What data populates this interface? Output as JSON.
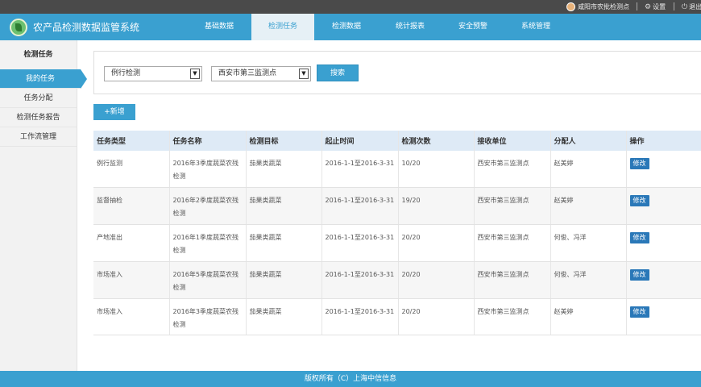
{
  "topbar": {
    "user": "咸阳市农批检测点",
    "settings": "设置",
    "logout": "退出"
  },
  "header": {
    "title": "农产品检测数据监管系统",
    "nav": [
      {
        "label": "基础数据",
        "active": false
      },
      {
        "label": "检测任务",
        "active": true
      },
      {
        "label": "检测数据",
        "active": false
      },
      {
        "label": "统计报表",
        "active": false
      },
      {
        "label": "安全预警",
        "active": false
      },
      {
        "label": "系统管理",
        "active": false
      }
    ]
  },
  "sidebar": {
    "heading": "检测任务",
    "items": [
      {
        "label": "我的任务",
        "active": true
      },
      {
        "label": "任务分配",
        "active": false
      },
      {
        "label": "检测任务报告",
        "active": false
      },
      {
        "label": "工作流管理",
        "active": false
      }
    ]
  },
  "filters": {
    "task_type": "例行检测",
    "station": "西安市第三监测点",
    "search_label": "搜索"
  },
  "add_label": "+新增",
  "table": {
    "columns": [
      "任务类型",
      "任务名称",
      "检测目标",
      "起止时间",
      "检测次数",
      "接收单位",
      "分配人",
      "操作"
    ],
    "rows": [
      {
        "type": "例行监测",
        "name": "2016年3季度蔬菜农残检测",
        "target": "茄果类蔬菜",
        "period": "2016-1-1至2016-3-31",
        "count": "10/20",
        "receiver": "西安市第三监测点",
        "assignee": "赵美婷",
        "action": "修改"
      },
      {
        "type": "监督抽检",
        "name": "2016年2季度蔬菜农残检测",
        "target": "茄果类蔬菜",
        "period": "2016-1-1至2016-3-31",
        "count": "19/20",
        "receiver": "西安市第三监测点",
        "assignee": "赵美婷",
        "action": "修改"
      },
      {
        "type": "产地准出",
        "name": "2016年1季度蔬菜农残检测",
        "target": "茄果类蔬菜",
        "period": "2016-1-1至2016-3-31",
        "count": "20/20",
        "receiver": "西安市第三监测点",
        "assignee": "何俊、冯洋",
        "action": "修改"
      },
      {
        "type": "市场准入",
        "name": "2016年5季度蔬菜农残检测",
        "target": "茄果类蔬菜",
        "period": "2016-1-1至2016-3-31",
        "count": "20/20",
        "receiver": "西安市第三监测点",
        "assignee": "何俊、冯洋",
        "action": "修改"
      },
      {
        "type": "市场准入",
        "name": "2016年3季度蔬菜农残检测",
        "target": "茄果类蔬菜",
        "period": "2016-1-1至2016-3-31",
        "count": "20/20",
        "receiver": "西安市第三监测点",
        "assignee": "赵美婷",
        "action": "修改"
      }
    ]
  },
  "footer": "版权所有（C）上海中信信息"
}
